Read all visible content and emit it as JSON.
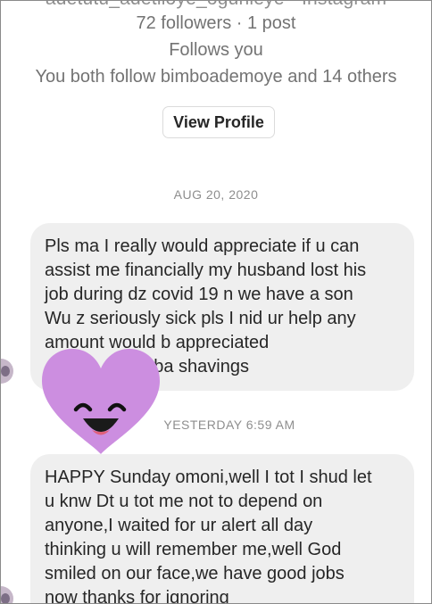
{
  "profile": {
    "username_cut": "adetutu_adetiloye_ogunleye · Instagram",
    "followers_text": "72 followers · 1 post",
    "follows_you_text": "Follows you",
    "mutual_text": "You both follow bimboademoye and 14 others",
    "view_profile_label": "View Profile"
  },
  "conversation": {
    "date_separator_1": "AUG 20, 2020",
    "message_1_lines": [
      "Pls ma I really would appreciate if u can",
      "assist me financially my husband lost his",
      "job during dz covid 19 n we have a son",
      "Wu z seriously sick pls I nid ur help any",
      "amount would b appreciated",
      "                    uba shavings"
    ],
    "date_separator_2": "YESTERDAY 6:59 AM",
    "message_2_lines": [
      "HAPPY Sunday omoni,well I tot I shud let",
      "u knw Dt u tot me not to depend on",
      "anyone,I waited for ur alert all day",
      "thinking u will remember me,well God",
      "smiled on our face,we have good jobs",
      "now thanks for ignoring"
    ]
  },
  "overlay": {
    "sticker": "purple-heart-smiley-sticker",
    "sticker_color": "#cc8ee0"
  },
  "colors": {
    "bubble_background": "#efefef",
    "secondary_text": "#737373",
    "timestamp_text": "#8e8e8e",
    "primary_text": "#262626"
  }
}
